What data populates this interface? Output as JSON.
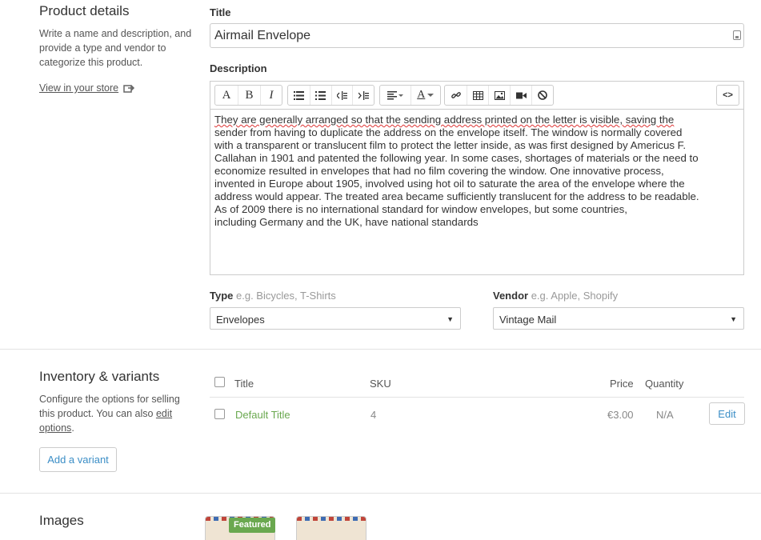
{
  "product_details": {
    "title": "Product details",
    "description": "Write a name and description, and provide a type and vendor to categorize this product.",
    "view_link": "View in your store"
  },
  "title_field": {
    "label": "Title",
    "value": "Airmail Envelope"
  },
  "description_field": {
    "label": "Description",
    "toolbar": {
      "bold": "B",
      "italic": "I",
      "font": "A",
      "html": "<>"
    },
    "lines": [
      "They are generally arranged so that the sending address printed on the letter is visible, saving the",
      "sender from having to duplicate the address on the envelope itself. The window is normally covered",
      "with a transparent or translucent film to protect the letter inside, as was first designed by Americus F.",
      "Callahan in 1901 and patented the following year. In some cases, shortages of materials or the need to",
      "economize resulted in envelopes that had no film covering the window. One innovative process,",
      "invented in Europe about 1905, involved using hot oil to saturate the area of the envelope where the",
      "address would appear. The treated area became sufficiently translucent for the address to be readable.",
      "As of 2009 there is no international standard for window envelopes, but some countries,",
      "including Germany and the UK, have national standards"
    ]
  },
  "type_field": {
    "label": "Type",
    "hint": "e.g. Bicycles, T-Shirts",
    "value": "Envelopes"
  },
  "vendor_field": {
    "label": "Vendor",
    "hint": "e.g. Apple, Shopify",
    "value": "Vintage Mail"
  },
  "inventory": {
    "title": "Inventory & variants",
    "description_pre": "Configure the options for selling this product. You can also ",
    "edit_link_1": "edit",
    "edit_link_2": "options",
    "description_post": ".",
    "add_variant": "Add a variant",
    "columns": {
      "title": "Title",
      "sku": "SKU",
      "price": "Price",
      "quantity": "Quantity"
    },
    "row": {
      "title": "Default Title",
      "sku": "4",
      "price": "€3.00",
      "quantity": "N/A",
      "edit": "Edit"
    }
  },
  "images": {
    "title": "Images",
    "featured_badge": "Featured"
  },
  "colors": {
    "link_green": "#6aa84f",
    "link_blue": "#3b8ec6",
    "badge_green": "#6aa84f"
  }
}
